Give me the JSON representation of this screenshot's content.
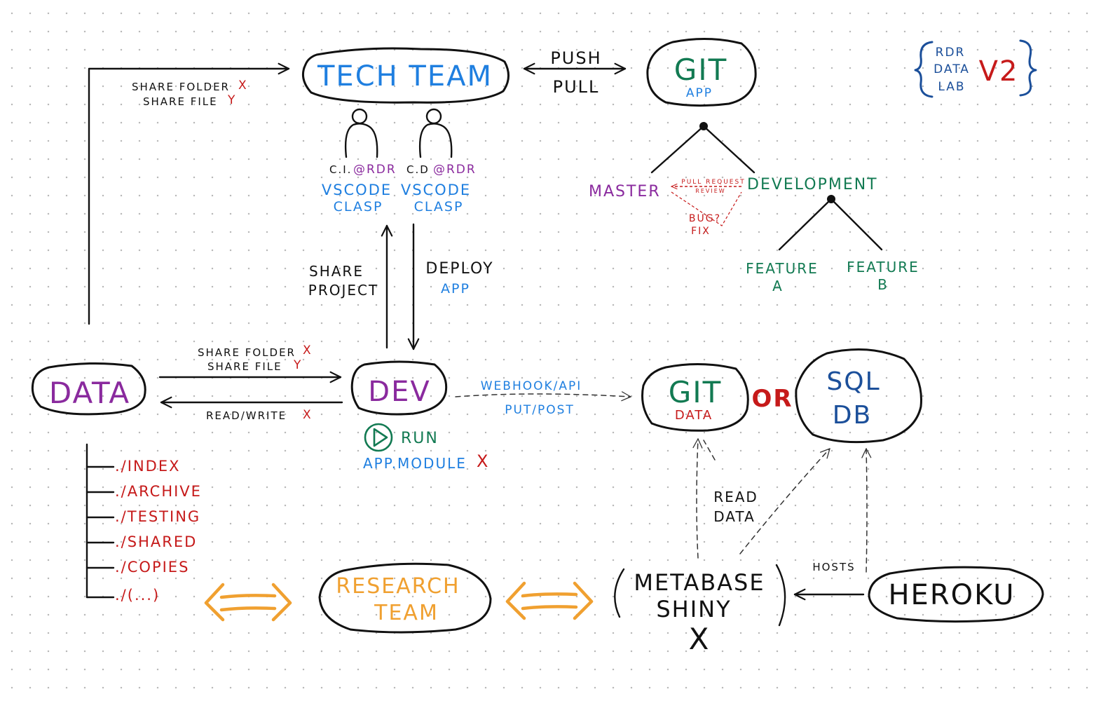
{
  "nodes": {
    "tech_team": "TECH TEAM",
    "git_app": {
      "title": "GIT",
      "sub": "APP"
    },
    "data": "DATA",
    "dev": "DEV",
    "git_data": {
      "title": "GIT",
      "sub": "DATA"
    },
    "or": "OR",
    "sql_db": {
      "line1": "SQL",
      "line2": "DB"
    },
    "research_team": {
      "line1": "RESEARCH",
      "line2": "TEAM"
    },
    "metabase": {
      "line1": "METABASE",
      "line2": "SHINY",
      "mark": "X"
    },
    "heroku": "HEROKU"
  },
  "badge": {
    "line1": "RDR",
    "line2": "DATA",
    "line3": "LAB",
    "version": "V2"
  },
  "edges": {
    "data_to_tech": {
      "line1": "SHARE FOLDER",
      "mark1": "X",
      "line2": "SHARE FILE",
      "mark2": "Y"
    },
    "push_pull": {
      "line1": "PUSH",
      "line2": "PULL"
    },
    "share_project": {
      "line1": "SHARE",
      "line2": "PROJECT"
    },
    "deploy_app": {
      "line1": "DEPLOY",
      "line2": "APP"
    },
    "data_to_dev": {
      "line1": "SHARE FOLDER",
      "mark1": "X",
      "line2": "SHARE FILE",
      "mark2": "Y"
    },
    "dev_to_data": {
      "line1": "READ/WRITE",
      "mark1": "X"
    },
    "webhook": {
      "line1": "WEBHOOK/API",
      "line2": "PUT/POST"
    },
    "read_data": {
      "line1": "READ",
      "line2": "DATA"
    },
    "hosts": "HOSTS"
  },
  "members": [
    {
      "id": "C.I.",
      "org": "@RDR",
      "tool1": "VSCODE",
      "tool2": "CLASP"
    },
    {
      "id": "C.D",
      "org": "@RDR",
      "tool1": "VSCODE",
      "tool2": "CLASP"
    }
  ],
  "git_tree": {
    "master": "MASTER",
    "development": "DEVELOPMENT",
    "pull_request": "PULL REQUEST",
    "review": "REVIEW",
    "bug": "BUG?",
    "fix": "FIX",
    "feature_a": {
      "line1": "FEATURE",
      "line2": "A"
    },
    "feature_b": {
      "line1": "FEATURE",
      "line2": "B"
    }
  },
  "run": {
    "label": "RUN",
    "module": "APP.MODULE",
    "mark": "X"
  },
  "folders": [
    "./INDEX",
    "./ARCHIVE",
    "./TESTING",
    "./SHARED",
    "./COPIES",
    "./(...)"
  ],
  "colors": {
    "ink": "#111111",
    "blue": "#1f7fe0",
    "navy": "#1b4f9a",
    "purple": "#8a2a9e",
    "green": "#127a52",
    "red": "#c61a1a",
    "orange": "#f0a030"
  }
}
